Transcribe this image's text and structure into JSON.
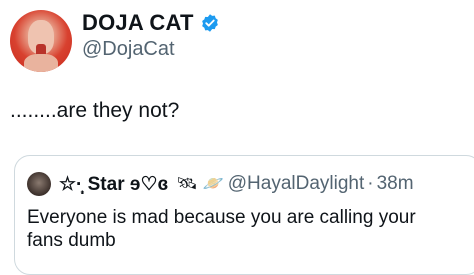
{
  "tweet": {
    "display_name": "DOJA CAT",
    "handle": "@DojaCat",
    "text": "........are they not?",
    "verified_color": "#1d9bf0"
  },
  "quoted": {
    "display_name": "☆·̩͙ Star ɘ♡ɞ",
    "emoji": "🛰 🪐",
    "handle": "@HayalDaylight",
    "separator": "·",
    "time": "38m",
    "text": "Everyone is mad because you are calling your fans dumb"
  }
}
